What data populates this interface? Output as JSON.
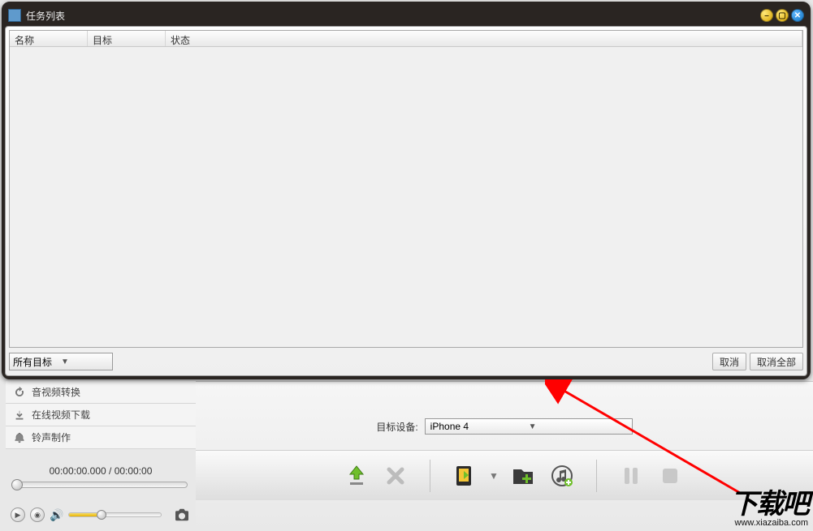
{
  "dialog": {
    "title": "任务列表",
    "columns": {
      "name": "名称",
      "target": "目标",
      "status": "状态"
    },
    "filter_label": "所有目标",
    "cancel_btn": "取消",
    "cancel_all_btn": "取消全部"
  },
  "sidebar": {
    "items": [
      {
        "icon": "refresh-icon",
        "label": "音视频转换"
      },
      {
        "icon": "download-icon",
        "label": "在线视频下载"
      },
      {
        "icon": "bell-icon",
        "label": "铃声制作"
      }
    ]
  },
  "timeline": {
    "current": "00:00:00.000",
    "separator": " / ",
    "total": "00:00:00"
  },
  "device": {
    "label": "目标设备:",
    "selected": "iPhone 4"
  },
  "watermark": {
    "big": "下载吧",
    "small": "www.xiazaiba.com"
  }
}
